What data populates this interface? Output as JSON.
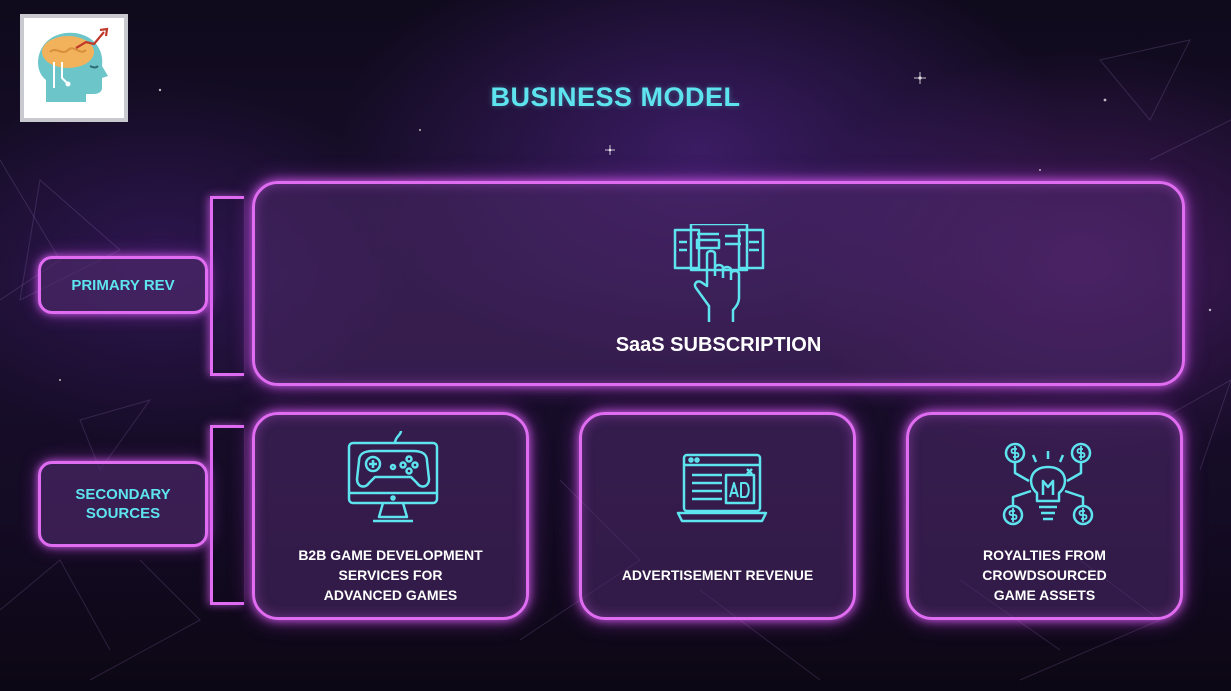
{
  "slide": {
    "title": "BUSINESS MODEL",
    "logo_icon": "brain-growth-logo-icon"
  },
  "primary": {
    "tag": "PRIMARY REV",
    "items": [
      {
        "label": "SaaS SUBSCRIPTION",
        "icon": "subscription-hand-icon"
      }
    ]
  },
  "secondary": {
    "tag_line1": "SECONDARY",
    "tag_line2": "SOURCES",
    "items": [
      {
        "line1": "B2B GAME DEVELOPMENT",
        "line2": "SERVICES FOR",
        "line3": "ADVANCED GAMES",
        "icon": "game-controller-monitor-icon"
      },
      {
        "line1": "ADVERTISEMENT REVENUE",
        "icon": "ad-laptop-icon"
      },
      {
        "line1": "ROYALTIES FROM",
        "line2": "CROWDSOURCED",
        "line3": "GAME ASSETS",
        "icon": "lightbulb-money-icon"
      }
    ]
  },
  "colors": {
    "accent_cyan": "#5ee4ef",
    "neon_pink": "#e06cf2",
    "background": "#140b24"
  }
}
